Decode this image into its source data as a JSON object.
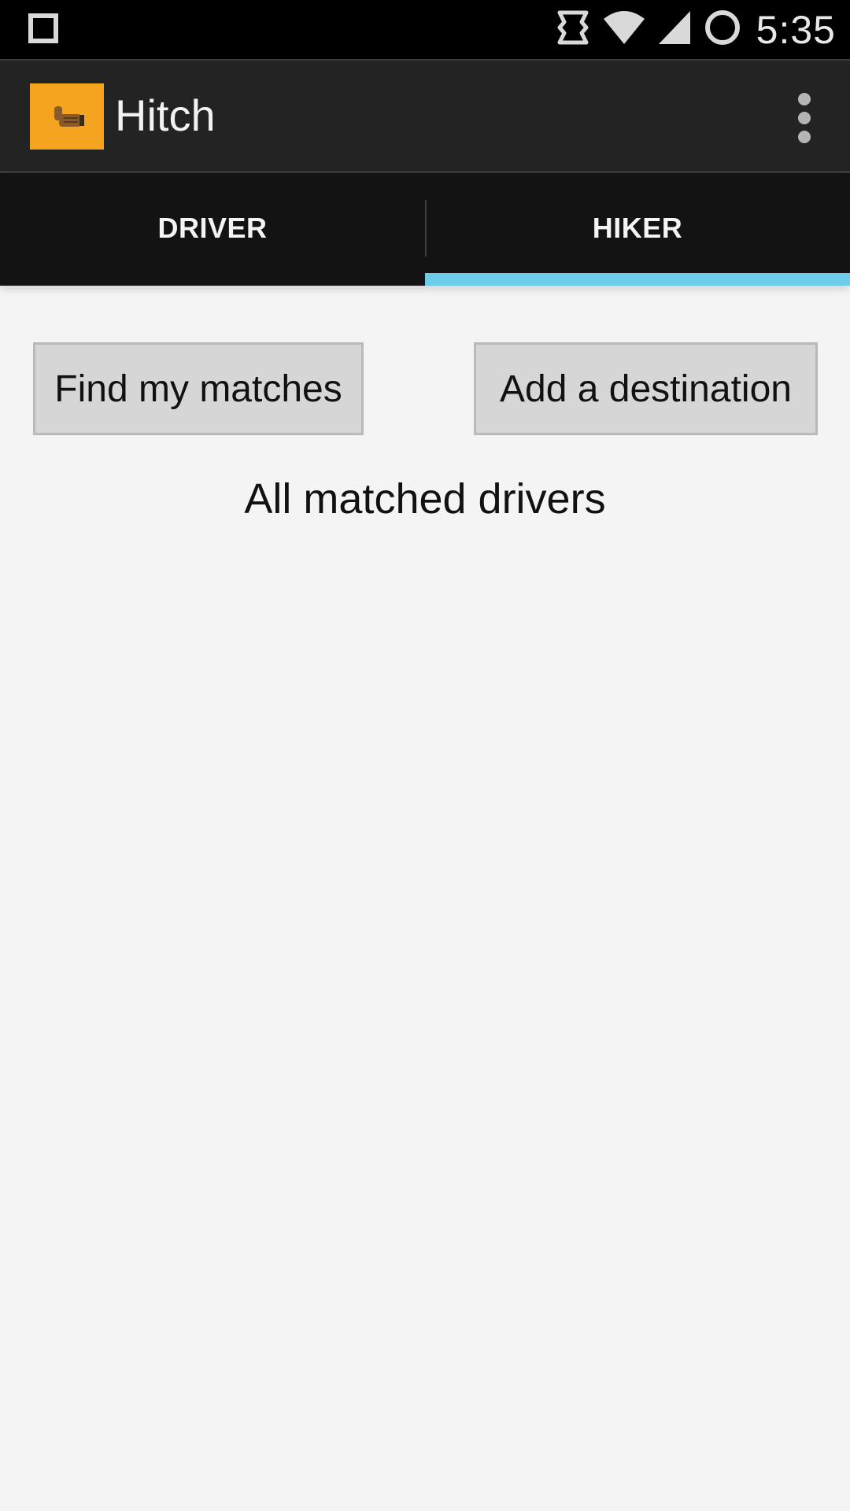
{
  "status_bar": {
    "time": "5:35",
    "icons": [
      "recent-apps-icon",
      "sync-icon",
      "wifi-icon",
      "signal-icon",
      "battery-ring-icon"
    ]
  },
  "app_bar": {
    "title": "Hitch",
    "icon": "thumbs-up-hitch-icon",
    "icon_background": "#f5a41f"
  },
  "tabs": [
    {
      "label": "DRIVER",
      "selected": false
    },
    {
      "label": "HIKER",
      "selected": true
    }
  ],
  "colors": {
    "tab_indicator": "#6dcde9",
    "tab_background": "#131313",
    "action_bar": "#232323",
    "content_background": "#f4f4f4",
    "button_background": "#d6d6d6"
  },
  "main": {
    "find_button_label": "Find my matches",
    "add_button_label": "Add a destination",
    "heading": "All matched drivers"
  }
}
